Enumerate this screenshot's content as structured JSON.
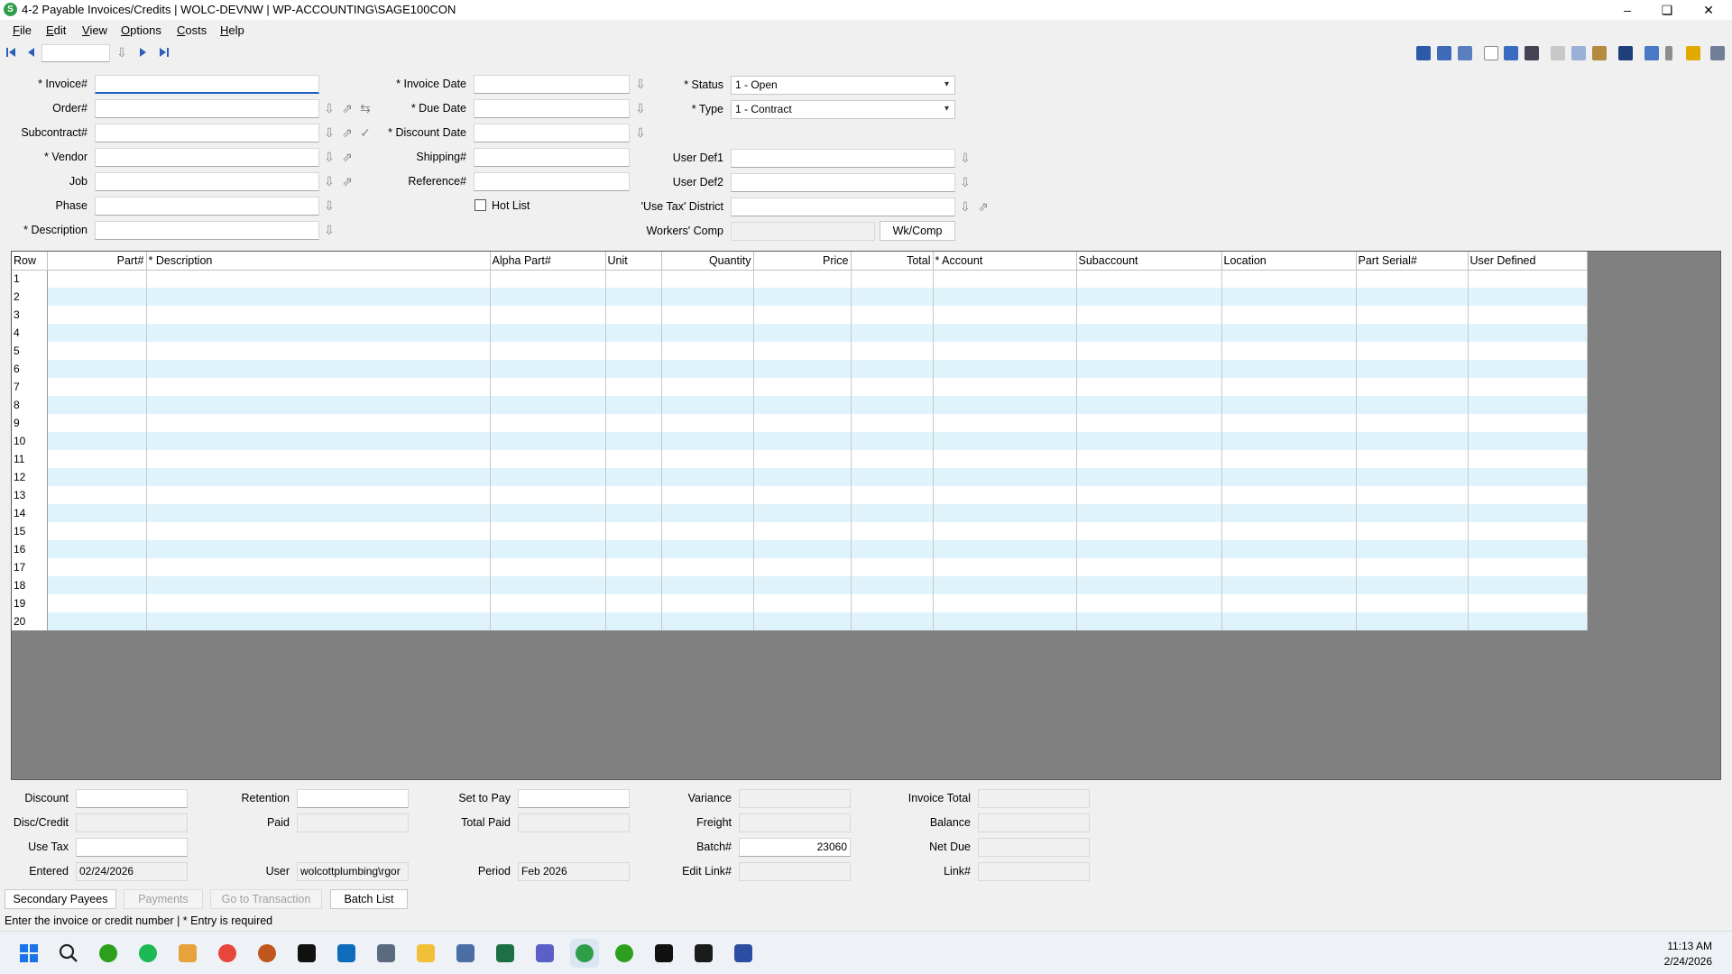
{
  "window": {
    "title": "4-2 Payable Invoices/Credits  |  WOLC-DEVNW  |  WP-ACCOUNTING\\SAGE100CON",
    "minimize": "–",
    "restore": "❏",
    "close": "✕"
  },
  "menu": [
    {
      "u": "F",
      "rest": "ile"
    },
    {
      "u": "E",
      "rest": "dit"
    },
    {
      "u": "V",
      "rest": "iew"
    },
    {
      "u": "O",
      "rest": "ptions"
    },
    {
      "u": "C",
      "rest": "osts"
    },
    {
      "u": "H",
      "rest": "elp"
    }
  ],
  "form": {
    "invoice_label": "* Invoice#",
    "order_label": "Order#",
    "subcontract_label": "Subcontract#",
    "vendor_label": "* Vendor",
    "job_label": "Job",
    "phase_label": "Phase",
    "description_label": "* Description",
    "invoice_date_label": "* Invoice Date",
    "due_date_label": "* Due Date",
    "discount_date_label": "* Discount Date",
    "shipping_label": "Shipping#",
    "reference_label": "Reference#",
    "hot_list_label": "Hot List",
    "status_label": "* Status",
    "status_value": "1 - Open",
    "type_label": "* Type",
    "type_value": "1 - Contract",
    "user_def1_label": "User Def1",
    "user_def2_label": "User Def2",
    "use_tax_district_label": "'Use Tax' District",
    "workers_comp_label": "Workers' Comp",
    "wk_comp_button": "Wk/Comp"
  },
  "grid": {
    "columns": [
      "Row",
      "Part#",
      "* Description",
      "Alpha Part#",
      "Unit",
      "Quantity",
      "Price",
      "Total",
      "* Account",
      "Subaccount",
      "Location",
      "Part Serial#",
      "User Defined"
    ],
    "rows": [
      "1",
      "2",
      "3",
      "4",
      "5",
      "6",
      "7",
      "8",
      "9",
      "10",
      "11",
      "12",
      "13",
      "14",
      "15",
      "16",
      "17",
      "18",
      "19",
      "20"
    ]
  },
  "totals": {
    "discount_label": "Discount",
    "disc_credit_label": "Disc/Credit",
    "use_tax_label": "Use Tax",
    "entered_label": "Entered",
    "entered_value": "02/24/2026",
    "retention_label": "Retention",
    "paid_label": "Paid",
    "user_label": "User",
    "user_value": "wolcottplumbing\\rgor",
    "set_to_pay_label": "Set to Pay",
    "total_paid_label": "Total Paid",
    "period_label": "Period",
    "period_value": "Feb 2026",
    "variance_label": "Variance",
    "freight_label": "Freight",
    "batch_label": "Batch#",
    "batch_value": "23060",
    "edit_link_label": "Edit Link#",
    "invoice_total_label": "Invoice Total",
    "balance_label": "Balance",
    "net_due_label": "Net Due",
    "link_label": "Link#"
  },
  "buttons": {
    "secondary_payees": "Secondary Payees",
    "payments": "Payments",
    "go_to_transaction": "Go to Transaction",
    "batch_list": "Batch List"
  },
  "status_bar": "Enter the invoice or credit number  |  * Entry is required",
  "taskbar": {
    "time": "11:13 AM",
    "date": "2/24/2026",
    "apps": [
      "windows-start",
      "search",
      "quickbooks",
      "spotify",
      "tool",
      "chrome",
      "app-ball",
      "spc",
      "outlook",
      "calculator",
      "file-explorer",
      "app-people",
      "excel",
      "teams",
      "sage",
      "quickbooks-2",
      "spc-2",
      "acrobat",
      "app-q"
    ]
  },
  "colors": {
    "grid_alt_row": "#dff3fa",
    "grid_background": "#808080",
    "accent": "#1c5fbf"
  }
}
